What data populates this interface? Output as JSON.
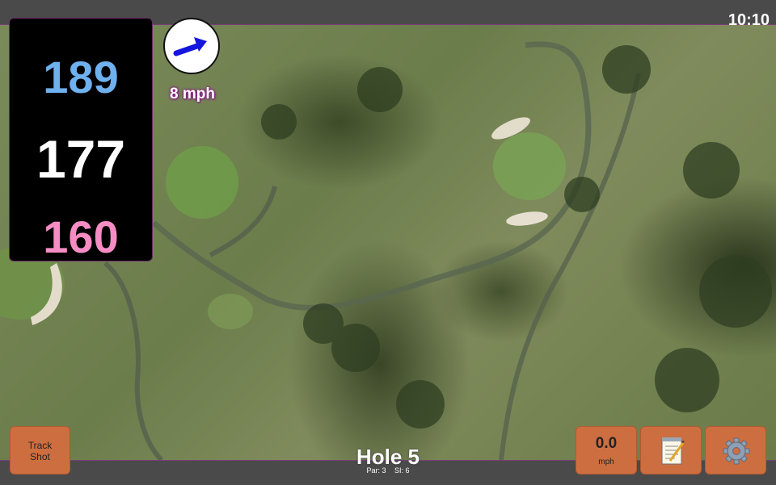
{
  "status_bar": {
    "time": "10:10"
  },
  "distances": {
    "back": "189",
    "middle": "177",
    "front": "160"
  },
  "wind": {
    "speed": "8 mph",
    "direction_icon": "wind-arrow-icon",
    "arrow_color": "#1515e0"
  },
  "hole": {
    "title": "Hole 5",
    "par": "Par: 3",
    "si": "SI: 6"
  },
  "buttons": {
    "track_shot_line1": "Track",
    "track_shot_line2": "Shot",
    "speed_value": "0.0",
    "speed_unit": "mph",
    "notes_icon": "notepad-icon",
    "settings_icon": "gear-icon"
  },
  "colors": {
    "back": "#6fb0ee",
    "middle": "#ffffff",
    "front": "#f58dc4",
    "button": "#cd6e41"
  }
}
